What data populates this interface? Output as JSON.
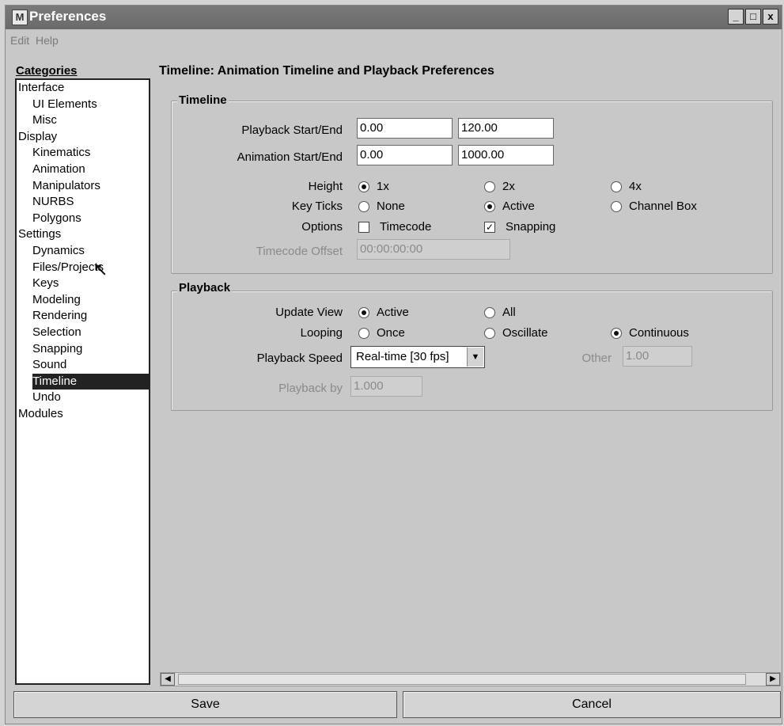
{
  "window": {
    "title": "Preferences",
    "app_icon": "M",
    "minimize": "_",
    "maximize": "□",
    "close": "x"
  },
  "menu": [
    "Edit",
    "Help"
  ],
  "categories": {
    "label": "Categories",
    "items": [
      {
        "label": "Interface",
        "indent": 0
      },
      {
        "label": "UI Elements",
        "indent": 1
      },
      {
        "label": "Misc",
        "indent": 1
      },
      {
        "label": "Display",
        "indent": 0
      },
      {
        "label": "Kinematics",
        "indent": 1
      },
      {
        "label": "Animation",
        "indent": 1
      },
      {
        "label": "Manipulators",
        "indent": 1
      },
      {
        "label": "NURBS",
        "indent": 1
      },
      {
        "label": "Polygons",
        "indent": 1
      },
      {
        "label": "Settings",
        "indent": 0
      },
      {
        "label": "Dynamics",
        "indent": 1
      },
      {
        "label": "Files/Projects",
        "indent": 1
      },
      {
        "label": "Keys",
        "indent": 1
      },
      {
        "label": "Modeling",
        "indent": 1
      },
      {
        "label": "Rendering",
        "indent": 1
      },
      {
        "label": "Selection",
        "indent": 1
      },
      {
        "label": "Snapping",
        "indent": 1
      },
      {
        "label": "Sound",
        "indent": 1
      },
      {
        "label": "Timeline",
        "indent": 1,
        "selected": true
      },
      {
        "label": "Undo",
        "indent": 1
      },
      {
        "label": "Modules",
        "indent": 0
      }
    ]
  },
  "main_title": "Timeline: Animation Timeline and Playback Preferences",
  "timeline": {
    "title": "Timeline",
    "playback_label": "Playback Start/End",
    "playback_start": "0.00",
    "playback_end": "120.00",
    "animation_label": "Animation Start/End",
    "animation_start": "0.00",
    "animation_end": "1000.00",
    "height_label": "Height",
    "height_1x": "1x",
    "height_2x": "2x",
    "height_4x": "4x",
    "keyticks_label": "Key Ticks",
    "keyticks_none": "None",
    "keyticks_active": "Active",
    "keyticks_channel": "Channel Box",
    "options_label": "Options",
    "timecode": "Timecode",
    "snapping": "Snapping",
    "timecode_offset_label": "Timecode Offset",
    "timecode_offset_value": "00:00:00:00"
  },
  "playback": {
    "title": "Playback",
    "update_label": "Update View",
    "update_active": "Active",
    "update_all": "All",
    "looping_label": "Looping",
    "looping_once": "Once",
    "looping_oscillate": "Oscillate",
    "looping_continuous": "Continuous",
    "speed_label": "Playback Speed",
    "speed_value": "Real-time [30 fps]",
    "other_label": "Other",
    "other_value": "1.00",
    "by_label": "Playback by",
    "by_value": "1.000"
  },
  "buttons": {
    "save": "Save",
    "cancel": "Cancel"
  }
}
